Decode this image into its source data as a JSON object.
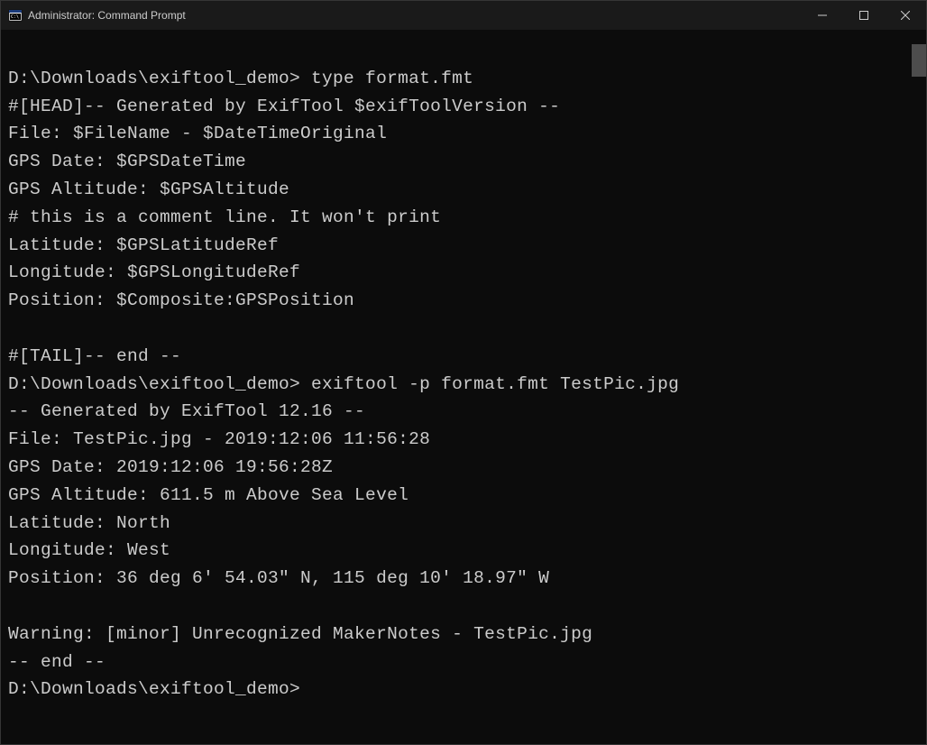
{
  "window": {
    "title": "Administrator: Command Prompt"
  },
  "terminal": {
    "lines": [
      "",
      "D:\\Downloads\\exiftool_demo> type format.fmt",
      "#[HEAD]-- Generated by ExifTool $exifToolVersion --",
      "File: $FileName - $DateTimeOriginal",
      "GPS Date: $GPSDateTime",
      "GPS Altitude: $GPSAltitude",
      "# this is a comment line. It won't print",
      "Latitude: $GPSLatitudeRef",
      "Longitude: $GPSLongitudeRef",
      "Position: $Composite:GPSPosition",
      "",
      "#[TAIL]-- end --",
      "D:\\Downloads\\exiftool_demo> exiftool -p format.fmt TestPic.jpg",
      "-- Generated by ExifTool 12.16 --",
      "File: TestPic.jpg - 2019:12:06 11:56:28",
      "GPS Date: 2019:12:06 19:56:28Z",
      "GPS Altitude: 611.5 m Above Sea Level",
      "Latitude: North",
      "Longitude: West",
      "Position: 36 deg 6' 54.03\" N, 115 deg 10' 18.97\" W",
      "",
      "Warning: [minor] Unrecognized MakerNotes - TestPic.jpg",
      "-- end --",
      "D:\\Downloads\\exiftool_demo>"
    ]
  }
}
